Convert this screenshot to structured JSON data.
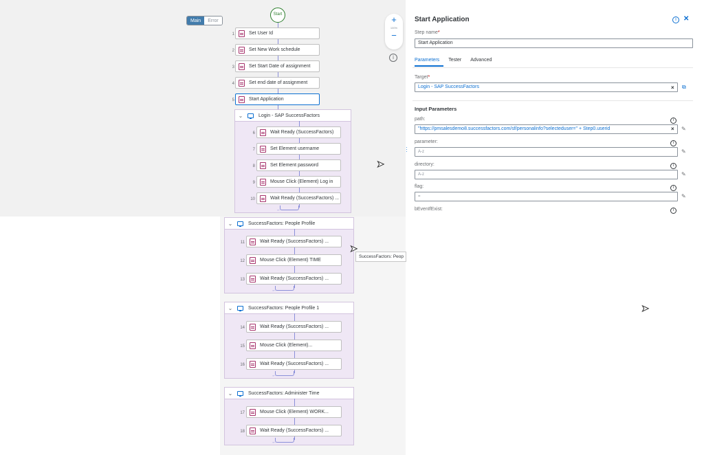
{
  "canvas": {
    "mode_tabs": [
      "Main",
      "Error"
    ],
    "zoom_plus": "+",
    "zoom_level": "100%",
    "zoom_minus": "−",
    "info_icon": "i",
    "start_label": "Start"
  },
  "steps": [
    {
      "n": "1",
      "label": "Set User Id"
    },
    {
      "n": "2",
      "label": "Set New Work schedule"
    },
    {
      "n": "3",
      "label": "Set Start Date of assignment"
    },
    {
      "n": "4",
      "label": "Set end date of assignment"
    },
    {
      "n": "5",
      "label": "Start Application"
    }
  ],
  "groups": [
    {
      "title": "Login - SAP SuccessFactors",
      "steps": [
        {
          "n": "6",
          "label": "Wait Ready (SuccessFactors)"
        },
        {
          "n": "7",
          "label": "Set Element username"
        },
        {
          "n": "8",
          "label": "Set Element password"
        },
        {
          "n": "9",
          "label": "Mouse Click (Element) Log in"
        },
        {
          "n": "10",
          "label": "Wait Ready (SuccessFactors) ..."
        }
      ]
    },
    {
      "title": "SuccessFactors: People Profile",
      "steps": [
        {
          "n": "11",
          "label": "Wait Ready (SuccessFactors) ..."
        },
        {
          "n": "12",
          "label": "Mouse Click (Element) TIME"
        },
        {
          "n": "13",
          "label": "Wait Ready (SuccessFactors) ..."
        }
      ]
    },
    {
      "title": "SuccessFactors: People Profile 1",
      "steps": [
        {
          "n": "14",
          "label": "Wait Ready (SuccessFactors) ..."
        },
        {
          "n": "15",
          "label": "Mouse Click (Element)..."
        },
        {
          "n": "16",
          "label": "Wait Ready (SuccessFactors) ..."
        }
      ]
    },
    {
      "title": "SuccessFactors: Administer Time",
      "steps": [
        {
          "n": "17",
          "label": "Mouse Click (Element) WORK..."
        },
        {
          "n": "18",
          "label": "Wait Ready (SuccessFactors) ..."
        }
      ]
    }
  ],
  "tooltip": "SuccessFactors: Peop",
  "panel": {
    "title": "Start Application",
    "step_name_label": "Step name",
    "step_name_value": "Start Application",
    "tabs": [
      "Parameters",
      "Tester",
      "Advanced"
    ],
    "target_label": "Target",
    "target_value": "Login - SAP SuccessFactors",
    "input_params_title": "Input Parameters",
    "params": [
      {
        "label": "path:",
        "value": "\"https://pmsalesdemo8.successfactors.com/sf/personalinfo?selecteduser=\" + Step0.userid"
      },
      {
        "label": "parameter:",
        "value": "A-z"
      },
      {
        "label": "directory:",
        "value": "A-z"
      },
      {
        "label": "flag:",
        "value": "="
      },
      {
        "label": "bEvenIfExist:",
        "value": ""
      }
    ]
  },
  "colors": {
    "accent": "#0a6ed1",
    "group_bg": "#efe7f5",
    "start": "#2b7d2b",
    "required": "#bb0000"
  }
}
